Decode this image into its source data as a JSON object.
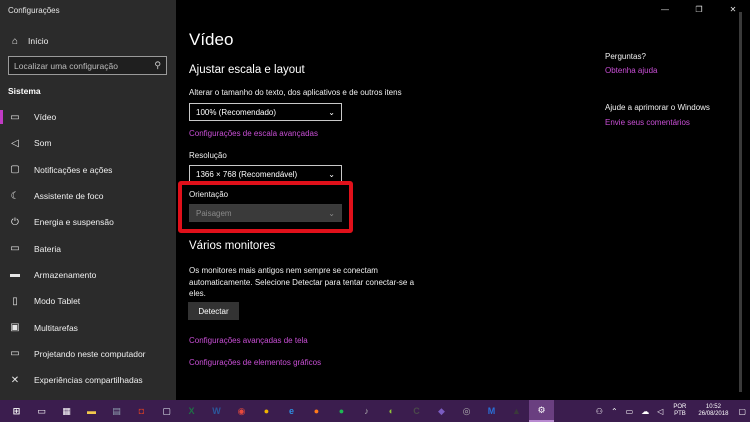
{
  "window": {
    "title": "Configurações",
    "controls": [
      "—",
      "❐",
      "✕"
    ]
  },
  "sidebar": {
    "home_label": "Início",
    "search_placeholder": "Localizar uma configuração",
    "section_label": "Sistema",
    "items": [
      {
        "label": "Vídeo",
        "icon": "monitor-icon",
        "active": true
      },
      {
        "label": "Som",
        "icon": "speaker-icon"
      },
      {
        "label": "Notificações e ações",
        "icon": "notification-icon"
      },
      {
        "label": "Assistente de foco",
        "icon": "moon-icon"
      },
      {
        "label": "Energia e suspensão",
        "icon": "power-icon"
      },
      {
        "label": "Bateria",
        "icon": "battery-icon"
      },
      {
        "label": "Armazenamento",
        "icon": "storage-icon"
      },
      {
        "label": "Modo Tablet",
        "icon": "tablet-icon"
      },
      {
        "label": "Multitarefas",
        "icon": "multitask-icon"
      },
      {
        "label": "Projetando neste computador",
        "icon": "project-icon"
      },
      {
        "label": "Experiências compartilhadas",
        "icon": "share-icon"
      }
    ]
  },
  "main": {
    "title": "Vídeo",
    "scale_heading": "Ajustar escala e layout",
    "scale_label": "Alterar o tamanho do texto, dos aplicativos e de outros itens",
    "scale_value": "100% (Recomendado)",
    "scale_link": "Configurações de escala avançadas",
    "resolution_label": "Resolução",
    "resolution_value": "1366 × 768 (Recomendável)",
    "orientation_label": "Orientação",
    "orientation_value": "Paisagem",
    "monitors_heading": "Vários monitores",
    "monitors_text": "Os monitores mais antigos nem sempre se conectam automaticamente. Selecione Detectar para tentar conectar-se a eles.",
    "detect_button": "Detectar",
    "advanced_link": "Configurações avançadas de tela",
    "graphics_link": "Configurações de elementos gráficos"
  },
  "right_panel": {
    "questions_heading": "Perguntas?",
    "help_link": "Obtenha ajuda",
    "improve_heading": "Ajude a aprimorar o Windows",
    "feedback_link": "Envie seus comentários"
  },
  "taskbar": {
    "icons": [
      {
        "name": "start-icon",
        "glyph": "⊞",
        "color": "#ffffff"
      },
      {
        "name": "task-view-icon",
        "glyph": "▭",
        "color": "#ffffff"
      },
      {
        "name": "calculator-icon",
        "glyph": "▦",
        "color": "#ffffff"
      },
      {
        "name": "file-explorer-icon",
        "glyph": "▬",
        "color": "#f2c94c"
      },
      {
        "name": "app-icon-1",
        "glyph": "▤",
        "color": "#8fa0b0"
      },
      {
        "name": "app-icon-2",
        "glyph": "◘",
        "color": "#c0392b"
      },
      {
        "name": "notepad-icon",
        "glyph": "▢",
        "color": "#dfe6ee"
      },
      {
        "name": "excel-icon",
        "glyph": "X",
        "color": "#1e7145"
      },
      {
        "name": "word-icon",
        "glyph": "W",
        "color": "#2b579a"
      },
      {
        "name": "media-icon",
        "glyph": "◉",
        "color": "#e84a3c"
      },
      {
        "name": "chrome-icon",
        "glyph": "●",
        "color": "#f0b400"
      },
      {
        "name": "edge-icon",
        "glyph": "e",
        "color": "#2f8ee0"
      },
      {
        "name": "firefox-icon",
        "glyph": "●",
        "color": "#ff7a1a"
      },
      {
        "name": "spotify-icon",
        "glyph": "●",
        "color": "#1db954"
      },
      {
        "name": "music-icon",
        "glyph": "♪",
        "color": "#b0b0b0"
      },
      {
        "name": "app-icon-3",
        "glyph": "◐",
        "color": "#8fc43a"
      },
      {
        "name": "app-icon-4",
        "glyph": "C",
        "color": "#4a4a4a"
      },
      {
        "name": "app-icon-5",
        "glyph": "◆",
        "color": "#7a5cc0"
      },
      {
        "name": "app-icon-6",
        "glyph": "◎",
        "color": "#b0b0b0"
      },
      {
        "name": "app-icon-7",
        "glyph": "M",
        "color": "#2a6fd6"
      },
      {
        "name": "app-icon-8",
        "glyph": "▲",
        "color": "#3a3a3a"
      },
      {
        "name": "settings-icon",
        "glyph": "⚙",
        "color": "#ffffff",
        "active": true
      }
    ],
    "lang_top": "POR",
    "lang_bottom": "PTB",
    "time": "10:52",
    "date": "26/08/2018"
  }
}
